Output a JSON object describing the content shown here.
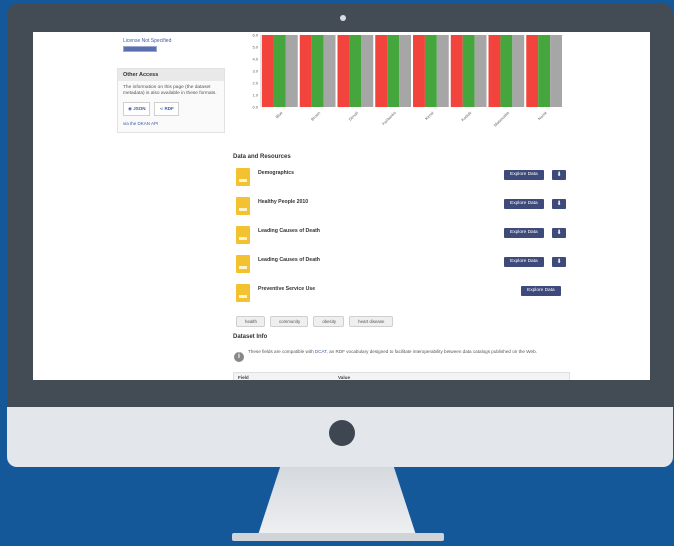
{
  "sidebar": {
    "license_link": "License Not Specified",
    "other_access_title": "Other Access",
    "other_access_text": "The information on this page (the dataset metadata) is also available in these formats.",
    "formats": [
      "JSON",
      "RDF"
    ],
    "api_link": "via the DKAN API"
  },
  "chart_data": {
    "type": "bar",
    "categories": [
      "Blue",
      "Brown",
      "Denali",
      "Fairbanks",
      "Kenai",
      "Kodiak",
      "Matanuska",
      "Nome"
    ],
    "ylim": [
      0,
      6
    ],
    "yticks": [
      "0.0",
      "1.0",
      "2.0",
      "3.0",
      "4.0",
      "5.0",
      "6.0"
    ],
    "series": [
      {
        "values": [
          6,
          6,
          6,
          6,
          6,
          6,
          6,
          6
        ]
      },
      {
        "values": [
          6,
          6,
          6,
          6,
          6,
          6,
          6,
          6
        ]
      },
      {
        "values": [
          6,
          6,
          6,
          6,
          6,
          6,
          6,
          6
        ]
      }
    ],
    "colors": [
      "#f2433d",
      "#44a63d",
      "#a6a6a6"
    ]
  },
  "resources": {
    "title": "Data and Resources",
    "items": [
      {
        "name": "Demographics",
        "explore": "Explore Data",
        "download": true
      },
      {
        "name": "Healthy People 2010",
        "explore": "Explore Data",
        "download": true
      },
      {
        "name": "Leading Causes of Death",
        "explore": "Explore Data",
        "download": true
      },
      {
        "name": "Leading Causes of Death",
        "explore": "Explore Data",
        "download": true
      },
      {
        "name": "Preventive Service Use",
        "explore": "Explore Data",
        "download": false
      }
    ]
  },
  "tags": [
    "health",
    "community",
    "obesity",
    "heart disease"
  ],
  "dataset_info": {
    "title": "Dataset Info",
    "note_pre": "These fields are compatible with ",
    "note_link": "DCAT",
    "note_post": ", an RDF vocabulary designed to facilitate interoperability between data catalogs published on the Web.",
    "col_field": "Field",
    "col_value": "Value"
  }
}
